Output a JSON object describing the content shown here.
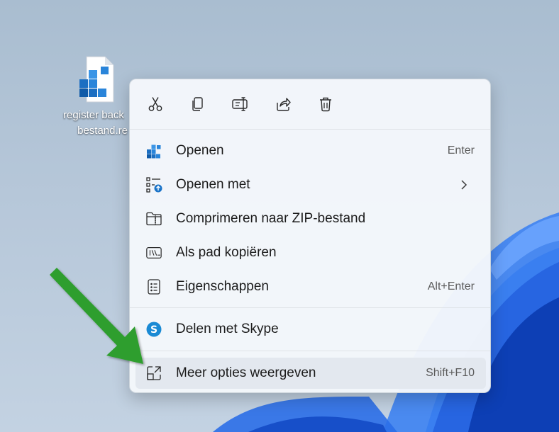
{
  "desktop": {
    "file_label_line1": "register back",
    "file_label_line2": "bestand.re"
  },
  "toolbar": {
    "cut": "scissors-icon",
    "copy": "copy-icon",
    "rename": "rename-icon",
    "share": "share-icon",
    "delete": "trash-icon"
  },
  "menu": {
    "items": [
      {
        "label": "Openen",
        "shortcut": "Enter",
        "icon": "registry-icon"
      },
      {
        "label": "Openen met",
        "shortcut": "",
        "icon": "open-with-icon"
      },
      {
        "label": "Comprimeren naar ZIP-bestand",
        "shortcut": "",
        "icon": "zip-folder-icon"
      },
      {
        "label": "Als pad kopiëren",
        "shortcut": "",
        "icon": "copy-path-icon"
      },
      {
        "label": "Eigenschappen",
        "shortcut": "Alt+Enter",
        "icon": "properties-icon"
      },
      {
        "label": "Delen met Skype",
        "shortcut": "",
        "icon": "skype-icon"
      },
      {
        "label": "Meer opties weergeven",
        "shortcut": "Shift+F10",
        "icon": "more-options-icon"
      }
    ]
  },
  "colors": {
    "menu_bg": "#f4f7fb",
    "hover_bg": "#e3e8ef",
    "arrow_green": "#2e9e2e",
    "accent_blue": "#1a73c8"
  }
}
